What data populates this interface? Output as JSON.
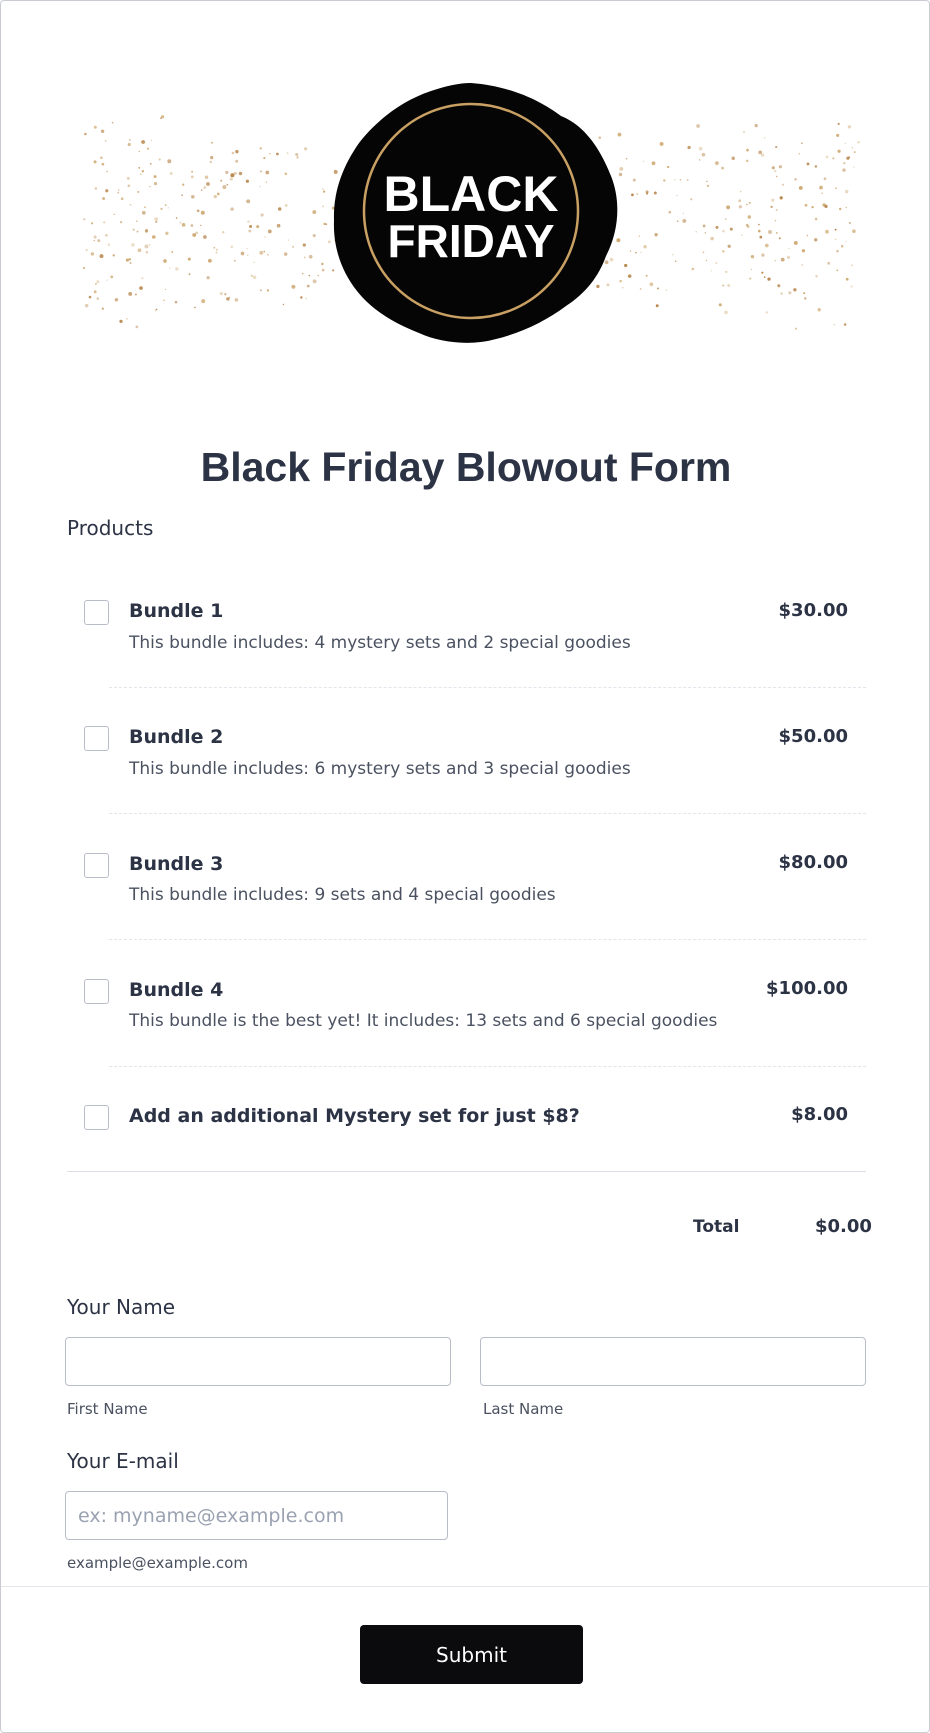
{
  "header": {
    "logo_line1": "BLACK",
    "logo_line2": "FRIDAY"
  },
  "form": {
    "title": "Black Friday Blowout Form",
    "products_label": "Products",
    "products": [
      {
        "name": "Bundle 1",
        "description": "This bundle includes: 4 mystery sets and 2 special goodies",
        "price": "$30.00",
        "checked": false
      },
      {
        "name": "Bundle 2",
        "description": "This bundle includes: 6 mystery sets and 3 special goodies",
        "price": "$50.00",
        "checked": false
      },
      {
        "name": "Bundle 3",
        "description": "This bundle includes: 9 sets and 4 special goodies",
        "price": "$80.00",
        "checked": false
      },
      {
        "name": "Bundle 4",
        "description": "This bundle is the best yet! It includes: 13 sets and 6 special goodies",
        "price": "$100.00",
        "checked": false
      },
      {
        "name": "Add an additional Mystery set for just $8?",
        "description": "",
        "price": "$8.00",
        "checked": false
      }
    ],
    "total_label": "Total",
    "total_value": "$0.00",
    "name_label": "Your Name",
    "first_name": {
      "value": "",
      "sublabel": "First Name"
    },
    "last_name": {
      "value": "",
      "sublabel": "Last Name"
    },
    "email_label": "Your E-mail",
    "email": {
      "value": "",
      "placeholder": "ex: myname@example.com",
      "sublabel": "example@example.com"
    },
    "submit_label": "Submit"
  },
  "colors": {
    "text": "#2c3345",
    "button_bg": "#0b0b0d",
    "gold": "#c9a063"
  }
}
